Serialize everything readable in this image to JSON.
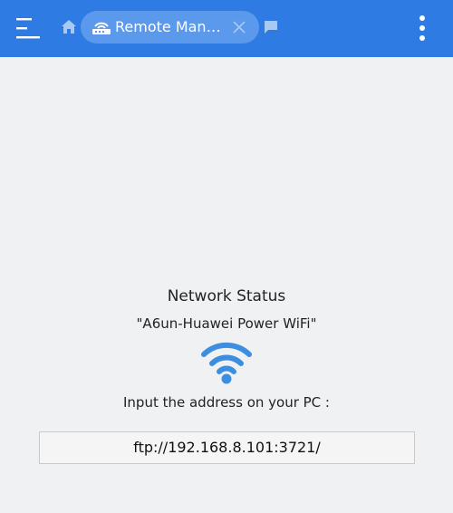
{
  "header": {
    "tab_label": "Remote Man…"
  },
  "icons": {
    "menu": "menu-icon",
    "home": "home-icon",
    "router": "router-icon",
    "close": "close-icon",
    "chat": "chat-icon",
    "more": "more-vertical-icon",
    "wifi": "wifi-icon"
  },
  "colors": {
    "header_bg": "#2e7ce3",
    "tab_bg": "#5a99ec",
    "wifi": "#3b8ee0",
    "page_bg": "#f0f1f3"
  },
  "main": {
    "status_title": "Network Status",
    "network_name": "\"A6un-Huawei Power WiFi\"",
    "instruction": "Input the address on your PC :",
    "ftp_address": "ftp://192.168.8.101:3721/"
  }
}
